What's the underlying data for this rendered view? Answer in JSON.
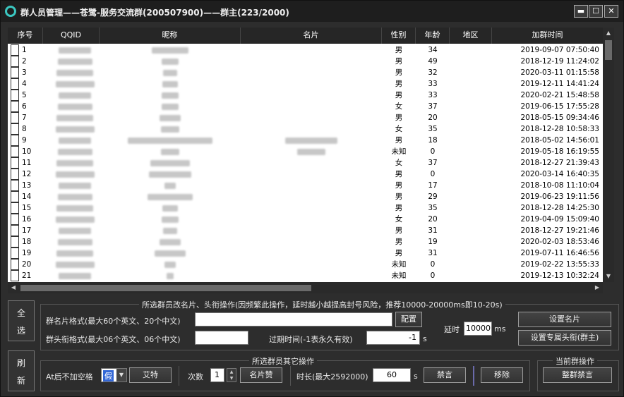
{
  "window": {
    "title": "群人员管理——苍鹭-服务交流群(200507900)——群主(223/2000)",
    "min_label": "▬",
    "max_label": "☐",
    "close_label": "✕"
  },
  "table": {
    "headers": [
      "序号",
      "QQID",
      "昵称",
      "名片",
      "性别",
      "年龄",
      "地区",
      "加群时间"
    ],
    "rows": [
      {
        "no": "1",
        "sex": "男",
        "age": "34",
        "time": "2019-09-07 07:50:40",
        "nick_w": 52,
        "card_w": 0
      },
      {
        "no": "2",
        "sex": "男",
        "age": "49",
        "time": "2018-12-19 11:24:02",
        "nick_w": 24,
        "card_w": 0
      },
      {
        "no": "3",
        "sex": "男",
        "age": "32",
        "time": "2020-03-11 01:15:58",
        "nick_w": 20,
        "card_w": 0
      },
      {
        "no": "4",
        "sex": "男",
        "age": "33",
        "time": "2019-12-11 14:41:24",
        "nick_w": 22,
        "card_w": 0
      },
      {
        "no": "5",
        "sex": "男",
        "age": "33",
        "time": "2020-02-21 15:48:58",
        "nick_w": 24,
        "card_w": 0
      },
      {
        "no": "6",
        "sex": "女",
        "age": "37",
        "time": "2019-06-15 17:55:28",
        "nick_w": 24,
        "card_w": 0
      },
      {
        "no": "7",
        "sex": "男",
        "age": "20",
        "time": "2018-05-15 09:34:46",
        "nick_w": 30,
        "card_w": 0
      },
      {
        "no": "8",
        "sex": "女",
        "age": "35",
        "time": "2018-12-28 10:58:33",
        "nick_w": 26,
        "card_w": 0
      },
      {
        "no": "9",
        "sex": "男",
        "age": "18",
        "time": "2018-05-02 14:56:01",
        "nick_w": 120,
        "card_w": 74
      },
      {
        "no": "10",
        "sex": "未知",
        "age": "0",
        "time": "2019-05-18 16:19:55",
        "nick_w": 26,
        "card_w": 40
      },
      {
        "no": "11",
        "sex": "女",
        "age": "37",
        "time": "2018-12-27 21:39:43",
        "nick_w": 56,
        "card_w": 0
      },
      {
        "no": "12",
        "sex": "男",
        "age": "0",
        "time": "2020-03-14 16:40:35",
        "nick_w": 60,
        "card_w": 0
      },
      {
        "no": "13",
        "sex": "男",
        "age": "17",
        "time": "2018-10-08 11:10:04",
        "nick_w": 16,
        "card_w": 0
      },
      {
        "no": "14",
        "sex": "男",
        "age": "29",
        "time": "2019-06-23 19:11:56",
        "nick_w": 64,
        "card_w": 0
      },
      {
        "no": "15",
        "sex": "男",
        "age": "35",
        "time": "2018-12-28 14:25:30",
        "nick_w": 22,
        "card_w": 0
      },
      {
        "no": "16",
        "sex": "女",
        "age": "20",
        "time": "2019-04-09 15:09:40",
        "nick_w": 24,
        "card_w": 0
      },
      {
        "no": "17",
        "sex": "男",
        "age": "31",
        "time": "2018-12-27 19:21:46",
        "nick_w": 20,
        "card_w": 0
      },
      {
        "no": "18",
        "sex": "男",
        "age": "19",
        "time": "2020-02-03 18:53:46",
        "nick_w": 30,
        "card_w": 0
      },
      {
        "no": "19",
        "sex": "男",
        "age": "31",
        "time": "2019-07-11 16:46:56",
        "nick_w": 44,
        "card_w": 0
      },
      {
        "no": "20",
        "sex": "未知",
        "age": "0",
        "time": "2019-02-22 13:55:33",
        "nick_w": 16,
        "card_w": 0
      },
      {
        "no": "21",
        "sex": "未知",
        "age": "0",
        "time": "2019-12-13 10:32:24",
        "nick_w": 10,
        "card_w": 0
      }
    ]
  },
  "top_panel": {
    "legend": "所选群员改名片、头衔操作(因频繁此操作，延时越小越提高封号风险，推荐10000-20000ms即10-20s)",
    "card_label": "群名片格式(最大60个英文、20个中文)",
    "card_value": "",
    "config_button": "配置",
    "title_label": "群头衔格式(最大06个英文、06个中文)",
    "title_value": "",
    "expire_label": "过期时间(-1表永久有效)",
    "expire_value": "-1",
    "expire_unit": "s",
    "delay_label": "延时",
    "delay_value": "10000",
    "delay_unit": "ms",
    "set_card_button": "设置名片",
    "set_title_button": "设置专属头衔(群主)"
  },
  "side": {
    "select_all_1": "全",
    "select_all_2": "选",
    "refresh_1": "刷",
    "refresh_2": "新"
  },
  "bottom_panel": {
    "legend": "所选群员其它操作",
    "at_label": "At后不加空格",
    "at_value": "假",
    "at_button": "艾特",
    "count_label": "次数",
    "count_value": "1",
    "like_button": "名片赞",
    "duration_label": "时长(最大2592000)",
    "duration_value": "60",
    "duration_unit": "s",
    "mute_button": "禁言",
    "remove_button": "移除"
  },
  "group_panel": {
    "legend": "当前群操作",
    "mute_all_button": "整群禁言"
  }
}
